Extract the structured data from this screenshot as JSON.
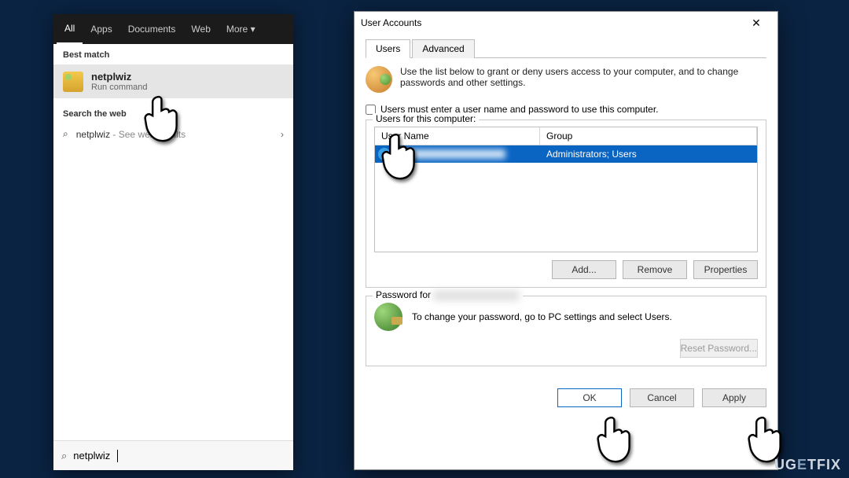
{
  "search": {
    "tabs": [
      "All",
      "Apps",
      "Documents",
      "Web",
      "More"
    ],
    "tabs_active_index": 0,
    "best_match_header": "Best match",
    "result": {
      "title": "netplwiz",
      "subtitle": "Run command"
    },
    "web_header": "Search the web",
    "web_row": {
      "term": "netplwiz",
      "suffix": " - See web results"
    },
    "input_value": "netplwiz"
  },
  "ua": {
    "title": "User Accounts",
    "tabs": {
      "users": "Users",
      "advanced": "Advanced"
    },
    "info": "Use the list below to grant or deny users access to your computer, and to change passwords and other settings.",
    "checkbox_label": "Users must enter a user name and password to use this computer.",
    "users_for_label": "Users for this computer:",
    "columns": {
      "name": "User Name",
      "group": "Group"
    },
    "row_group": "Administrators; Users",
    "buttons": {
      "add": "Add...",
      "remove": "Remove",
      "properties": "Properties",
      "reset": "Reset Password...",
      "ok": "OK",
      "cancel": "Cancel",
      "apply": "Apply"
    },
    "password_for_prefix": "Password for",
    "password_hint": "To change your password, go to PC settings and select Users."
  },
  "watermark": "UGETFIX"
}
